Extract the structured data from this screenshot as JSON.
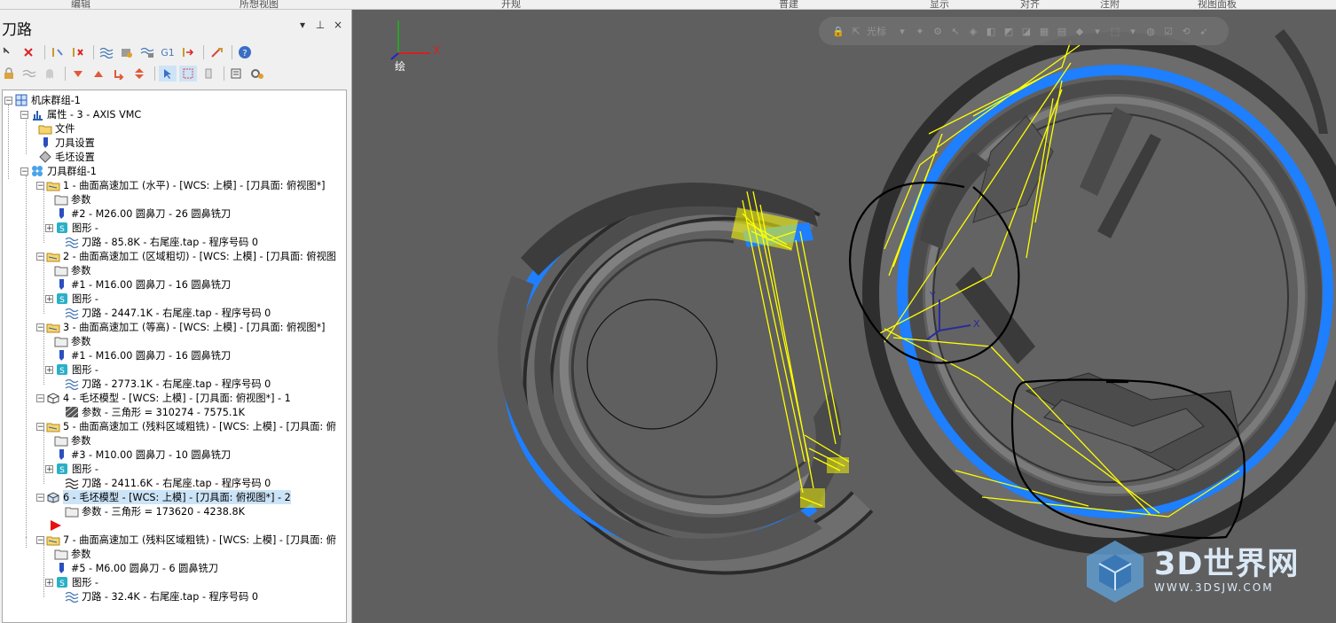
{
  "ribbon": {
    "groups": [
      "编辑",
      "所想视图",
      "开规",
      "普建",
      "显示",
      "对齐",
      "注附",
      "视图面板"
    ]
  },
  "panel": {
    "title": "刀路",
    "pin": "ᵖ",
    "close": "×"
  },
  "tree": {
    "root": "机床群组-1",
    "props": "属性 - 3 - AXIS VMC",
    "files": "文件",
    "toolsettings": "刀具设置",
    "stocksettings": "毛坯设置",
    "toolgroup": "刀具群组-1",
    "ops": [
      {
        "title": "1 - 曲面高速加工 (水平) - [WCS: 上模] - [刀具面: 俯视图*]",
        "params": "参数",
        "tool": "#2 - M26.00 圆鼻刀 - 26 圆鼻铣刀",
        "geo": "图形 -",
        "path": "刀路 - 85.8K - 右尾座.tap - 程序号码 0"
      },
      {
        "title": "2 - 曲面高速加工 (区域粗切) - [WCS: 上模] - [刀具面: 俯视图",
        "params": "参数",
        "tool": "#1 - M16.00 圆鼻刀 - 16 圆鼻铣刀",
        "geo": "图形 -",
        "path": "刀路 - 2447.1K - 右尾座.tap - 程序号码 0"
      },
      {
        "title": "3 - 曲面高速加工 (等高) - [WCS: 上模] - [刀具面: 俯视图*]",
        "params": "参数",
        "tool": "#1 - M16.00 圆鼻刀 - 16 圆鼻铣刀",
        "geo": "图形 -",
        "path": "刀路 - 2773.1K - 右尾座.tap - 程序号码 0"
      },
      {
        "title": "4 - 毛坯模型 - [WCS: 上模] - [刀具面: 俯视图*] - 1",
        "params": "参数 - 三角形 = 310274 - 7575.1K"
      },
      {
        "title": "5 - 曲面高速加工 (残料区域粗铣) - [WCS: 上模] - [刀具面: 俯",
        "params": "参数",
        "tool": "#3 - M10.00 圆鼻刀 - 10 圆鼻铣刀",
        "geo": "图形 -",
        "path": "刀路 - 2411.6K - 右尾座.tap - 程序号码 0"
      },
      {
        "title": "6 - 毛坯模型 - [WCS: 上模] - [刀具面: 俯视图*] - 2",
        "params": "参数 - 三角形 = 173620 - 4238.8K"
      },
      {
        "title": "7 - 曲面高速加工 (残料区域粗铣) - [WCS: 上模] - [刀具面: 俯",
        "params": "参数",
        "tool": "#5 - M6.00 圆鼻刀 - 6 圆鼻铣刀",
        "geo": "图形 -",
        "path": "刀路 - 32.4K - 右尾座.tap - 程序号码 0"
      }
    ]
  },
  "viewport": {
    "toolbar_label": "光标",
    "axis_x": "X",
    "axis_y": "Y",
    "axis_mode": "绘",
    "wcs_x": "X",
    "wcs_y": "Y"
  },
  "watermark": {
    "brand": "3D世界网",
    "url": "WWW.3DSJW.COM"
  },
  "colors": {
    "panel_bg": "#f0f0f0",
    "viewport_bg": "#5f5f5f",
    "toolpath": "#ffff00",
    "stock_highlight": "#1e7fff",
    "annotation": "#000000"
  }
}
